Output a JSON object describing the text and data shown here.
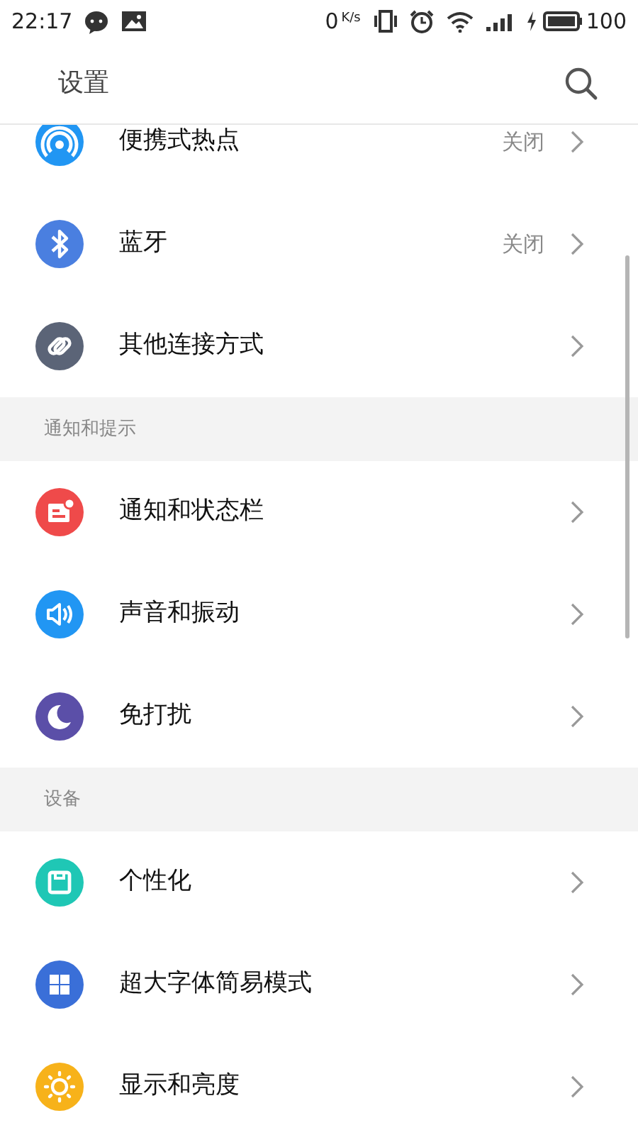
{
  "status_bar": {
    "time": "22:17",
    "speed": "0",
    "speed_unit": "K/s",
    "battery": "100"
  },
  "header": {
    "title": "设置"
  },
  "sections": [
    {
      "items": [
        {
          "kind": "hotspot",
          "label": "便携式热点",
          "value": "关闭",
          "color": "#2196f3"
        },
        {
          "kind": "bluetooth",
          "label": "蓝牙",
          "value": "关闭",
          "color": "#4a7fe0"
        },
        {
          "kind": "link",
          "label": "其他连接方式",
          "color": "#5b6477"
        }
      ]
    },
    {
      "title": "通知和提示",
      "items": [
        {
          "kind": "notice",
          "label": "通知和状态栏",
          "color": "#ef4a4a"
        },
        {
          "kind": "sound",
          "label": "声音和振动",
          "color": "#2196f3"
        },
        {
          "kind": "moon",
          "label": "免打扰",
          "color": "#5b4fa8"
        }
      ]
    },
    {
      "title": "设备",
      "items": [
        {
          "kind": "personal",
          "label": "个性化",
          "color": "#1fc7b5"
        },
        {
          "kind": "grid",
          "label": "超大字体简易模式",
          "color": "#3a6fd8"
        },
        {
          "kind": "sun",
          "label": "显示和亮度",
          "color": "#f7b21a"
        }
      ]
    }
  ]
}
